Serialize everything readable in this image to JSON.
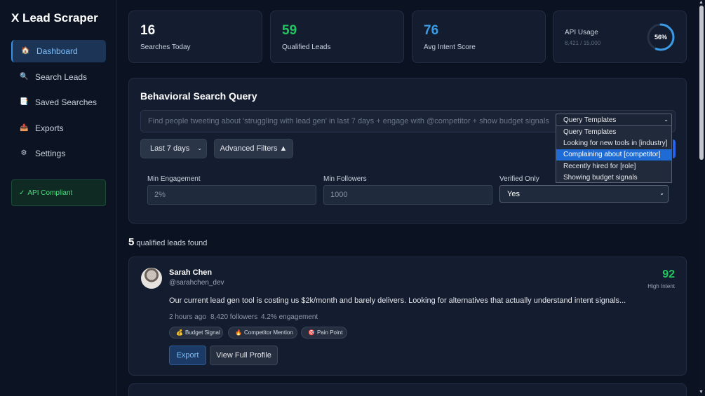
{
  "app": {
    "title": "X Lead Scraper"
  },
  "sidebar": {
    "items": [
      {
        "label": "Dashboard",
        "icon": "house-icon",
        "active": true
      },
      {
        "label": "Search Leads",
        "icon": "search-icon"
      },
      {
        "label": "Saved Searches",
        "icon": "document-icon"
      },
      {
        "label": "Exports",
        "icon": "clipboard-icon"
      },
      {
        "label": "Settings",
        "icon": "gear-icon"
      }
    ],
    "compliant_label": "API Compliant"
  },
  "stats": {
    "searches": {
      "value": "16",
      "label": "Searches Today"
    },
    "qualified": {
      "value": "59",
      "label": "Qualified Leads"
    },
    "intent": {
      "value": "76",
      "label": "Avg Intent Score"
    },
    "api": {
      "label": "API Usage",
      "usage": "8,421 / 15,000",
      "percent_text": "56%",
      "percent": 0.56
    }
  },
  "query": {
    "title": "Behavioral Search Query",
    "placeholder": "Find people tweeting about 'struggling with lead gen' in last 7 days + engage with @competitor + show budget signals",
    "templates_selected": "Query Templates",
    "templates_options": [
      "Query Templates",
      "Looking for new tools in [industry]",
      "Complaining about [competitor]",
      "Recently hired for [role]",
      "Showing budget signals"
    ],
    "highlighted_option_index": 2,
    "range_label": "Last 7 days",
    "advanced_label": "Advanced Filters ▲",
    "filters": {
      "min_engagement": {
        "label": "Min Engagement",
        "placeholder": "2%"
      },
      "min_followers": {
        "label": "Min Followers",
        "placeholder": "1000"
      },
      "verified_only": {
        "label": "Verified Only",
        "value": "Yes"
      }
    }
  },
  "results": {
    "count": "5",
    "label": "qualified leads found"
  },
  "lead": {
    "name": "Sarah Chen",
    "handle": "@sarahchen_dev",
    "score": "92",
    "score_label": "High Intent",
    "tweet": "Our current lead gen tool is costing us $2k/month and barely delivers. Looking for alternatives that actually understand intent signals...",
    "time": "2 hours ago",
    "followers": "8,420 followers",
    "engagement": "4.2% engagement",
    "tags": [
      {
        "label": "Budget Signal",
        "icon": "money-bag-icon"
      },
      {
        "label": "Competitor Mention",
        "icon": "fire-icon"
      },
      {
        "label": "Pain Point",
        "icon": "target-icon"
      }
    ],
    "export_label": "Export",
    "view_label": "View Full Profile"
  },
  "colors": {
    "background": "#0b1222",
    "card": "#141d30",
    "accent_blue": "#3b9ce6",
    "accent_green": "#22c55e"
  }
}
